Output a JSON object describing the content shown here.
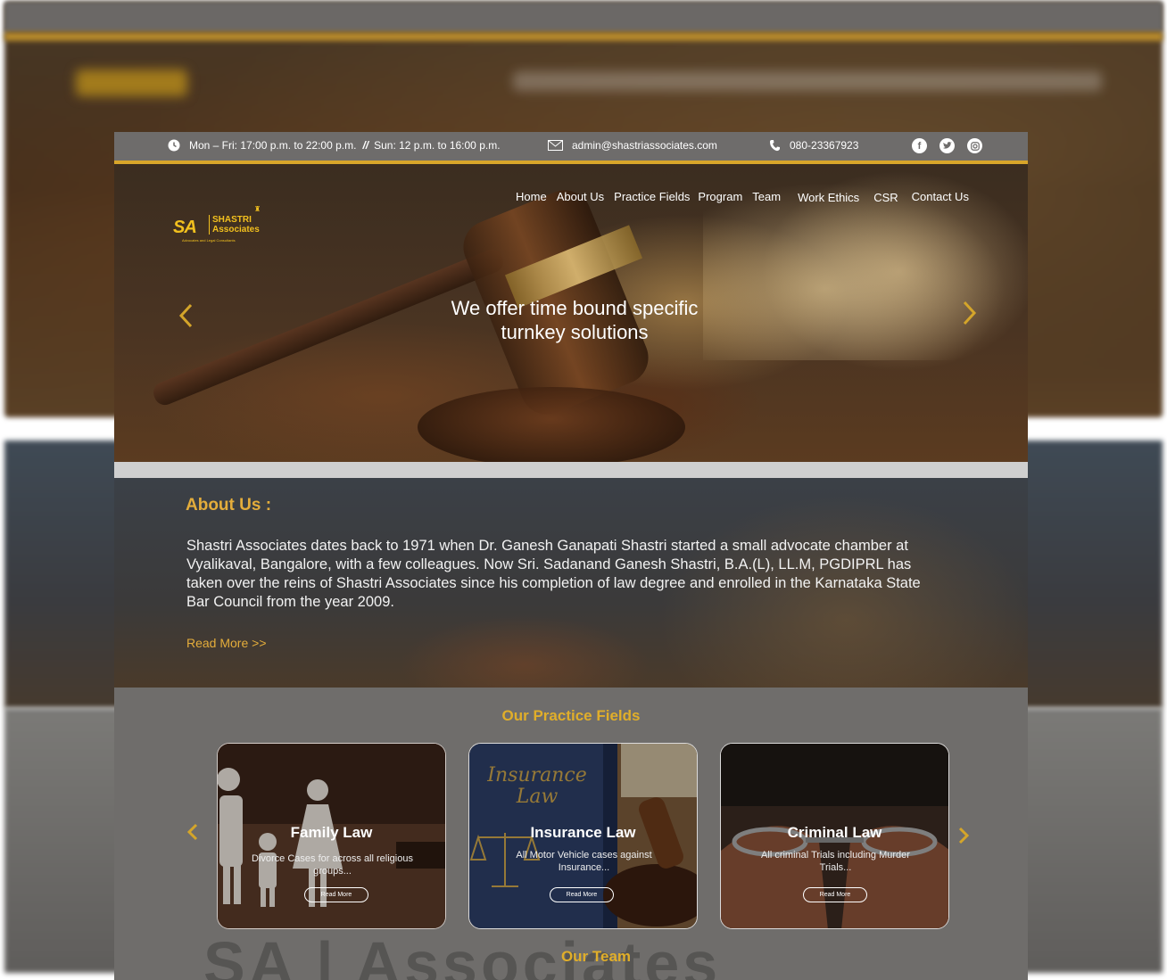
{
  "topbar": {
    "hours_weekday": "Mon – Fri: 17:00 p.m. to 22:00 p.m.",
    "separator": "//",
    "hours_sunday": "Sun: 12 p.m. to 16:00 p.m.",
    "email": "admin@shastriassociates.com",
    "phone": "080-23367923",
    "social": [
      "facebook-icon",
      "twitter-icon",
      "instagram-icon"
    ]
  },
  "logo": {
    "initials": "SA",
    "name_line1": "SHASTRI",
    "name_line2": "Associates",
    "tagline": "Advocates and Legal Consultants"
  },
  "nav": {
    "items": [
      "Home",
      "About Us",
      "Practice Fields",
      "Program",
      "Team",
      "Work Ethics",
      "CSR",
      "Contact Us"
    ]
  },
  "hero": {
    "title_line1": "We offer time bound specific",
    "title_line2": "turnkey solutions",
    "prev_icon": "chevron-left-icon",
    "next_icon": "chevron-right-icon"
  },
  "about": {
    "title": "About Us :",
    "text": "Shastri Associates dates back to 1971 when Dr. Ganesh Ganapati Shastri started a small advocate chamber at Vyalikaval, Bangalore, with a few colleagues.  Now Sri. Sadanand Ganesh Shastri, B.A.(L), LL.M, PGDIPRL has taken over the reins of Shastri Associates since his completion of law degree and enrolled in the Karnataka State Bar Council from the year 2009.",
    "read_more": "Read More  >>"
  },
  "practice": {
    "title": "Our Practice Fields",
    "cards": [
      {
        "title": "Family Law",
        "desc": "Divorce Cases for across all religious groups...",
        "button": "Read More"
      },
      {
        "title": "Insurance Law",
        "desc": "All Motor Vehicle cases against Insurance...",
        "button": "Read More",
        "image_text": "Insurance Law"
      },
      {
        "title": "Criminal Law",
        "desc": "All criminal Trials including Murder Trials...",
        "button": "Read More"
      }
    ]
  },
  "team": {
    "title": "Our Team"
  },
  "colors": {
    "accent": "#e0ae2a",
    "topbar": "#6e6c6b"
  }
}
